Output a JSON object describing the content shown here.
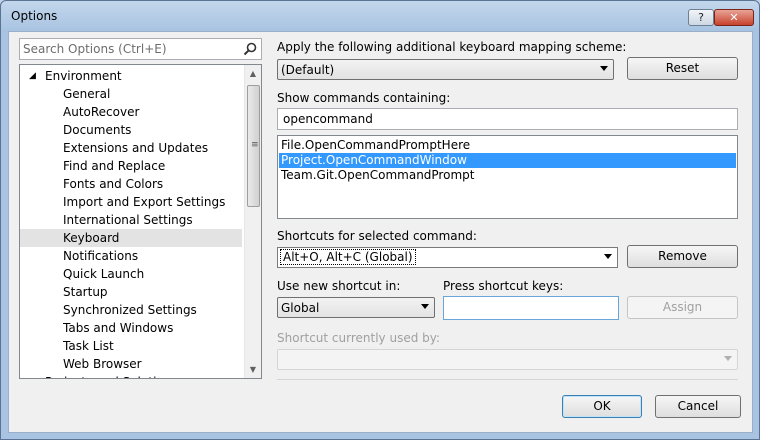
{
  "window": {
    "title": "Options",
    "help_label": "?",
    "close_label": "✕"
  },
  "search": {
    "placeholder": "Search Options (Ctrl+E)",
    "icon": "magnifier-icon"
  },
  "tree": {
    "root_label": "Environment",
    "children": [
      "General",
      "AutoRecover",
      "Documents",
      "Extensions and Updates",
      "Find and Replace",
      "Fonts and Colors",
      "Import and Export Settings",
      "International Settings",
      "Keyboard",
      "Notifications",
      "Quick Launch",
      "Startup",
      "Synchronized Settings",
      "Tabs and Windows",
      "Task List",
      "Web Browser"
    ],
    "partial_label": "Projects and Solutions",
    "selected": "Keyboard"
  },
  "mapping": {
    "label": "Apply the following additional keyboard mapping scheme:",
    "value": "(Default)",
    "reset_label": "Reset"
  },
  "commands": {
    "label": "Show commands containing:",
    "filter_value": "opencommand",
    "items": [
      "File.OpenCommandPromptHere",
      "Project.OpenCommandWindow",
      "Team.Git.OpenCommandPrompt"
    ],
    "selected": "Project.OpenCommandWindow"
  },
  "shortcuts": {
    "label": "Shortcuts for selected command:",
    "value": "Alt+O, Alt+C (Global)",
    "remove_label": "Remove"
  },
  "new_shortcut": {
    "use_in_label": "Use new shortcut in:",
    "use_in_value": "Global",
    "press_label": "Press shortcut keys:",
    "press_value": "",
    "assign_label": "Assign"
  },
  "used_by": {
    "label": "Shortcut currently used by:",
    "value": ""
  },
  "footer": {
    "ok_label": "OK",
    "cancel_label": "Cancel"
  },
  "colors": {
    "selection": "#3399ff",
    "tree_selected": "#e3e3e3",
    "dialog_bg": "#f0f0f0"
  }
}
